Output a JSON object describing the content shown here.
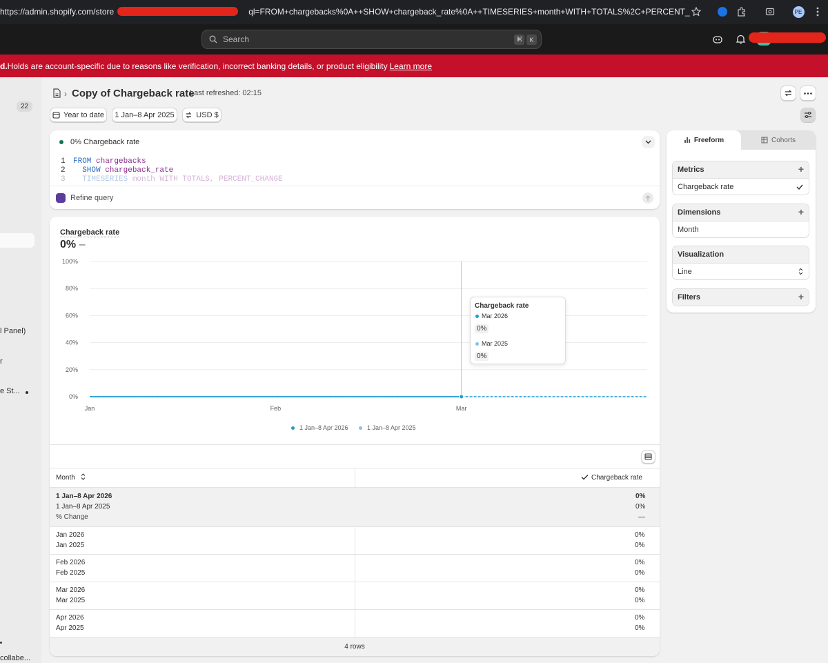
{
  "browser": {
    "url": "https://admin.shopify.com/store",
    "url_tail": "ql=FROM+chargebacks%0A++SHOW+chargeback_rate%0A++TIMESERIES+month+WITH+TOTALS%2C+PERCENT_CHANG...",
    "profile_initials": "PE"
  },
  "topbar": {
    "search_placeholder": "Search",
    "shortcut_key1": "⌘",
    "shortcut_key2": "K"
  },
  "banner": {
    "text_prefix": "d.",
    "text": " Holds are account-specific due to reasons like verification, incorrect banking details, or product eligibility",
    "link": "Learn more",
    "color": "#c4102a"
  },
  "sidebar": {
    "badge": "22",
    "items": [
      "l Panel)",
      "r",
      "e St...",
      "collabe..."
    ]
  },
  "header": {
    "title": "Copy of Chargeback rate",
    "refreshed": "Last refreshed: 02:15"
  },
  "filters": {
    "date_range": "Year to date",
    "compare": "1 Jan–8 Apr 2025",
    "currency": "USD $"
  },
  "query": {
    "status": "0% Chargeback rate",
    "lines": [
      {
        "num": "1",
        "kw": "FROM",
        "rest": " chargebacks"
      },
      {
        "num": "2",
        "kw": "SHOW",
        "rest": " chargeback_rate"
      },
      {
        "num": "3",
        "kw": "TIMESERIES",
        "rest": " month WITH TOTALS, PERCENT_CHANGE"
      }
    ],
    "refine": "Refine query"
  },
  "chart_data": {
    "type": "line",
    "title": "Chargeback rate",
    "headline": "0%",
    "headline_delta": "–",
    "xlabel": "",
    "ylabel": "",
    "categories": [
      "Jan",
      "Feb",
      "Mar",
      "Apr"
    ],
    "x_tick_labels": [
      "Jan",
      "Feb",
      "Mar"
    ],
    "y_tick_labels": [
      "100%",
      "80%",
      "60%",
      "40%",
      "20%",
      "0%"
    ],
    "ylim": [
      0,
      100
    ],
    "grid": true,
    "legend_position": "bottom",
    "series": [
      {
        "name": "1 Jan–8 Apr 2026",
        "values": [
          0,
          0,
          0,
          0
        ],
        "color": "#1f9bd1",
        "style": "solid"
      },
      {
        "name": "1 Jan–8 Apr 2025",
        "values": [
          0,
          0,
          0,
          0
        ],
        "color": "#7fc4e6",
        "style": "dashed"
      }
    ],
    "tooltip": {
      "title": "Chargeback rate",
      "rows": [
        {
          "label": "Mar 2026",
          "value": "0%"
        },
        {
          "label": "Mar 2025",
          "value": "0%"
        }
      ]
    }
  },
  "table": {
    "col_month": "Month",
    "col_metric": "Chargeback rate",
    "totals": {
      "row1_label": "1 Jan–8 Apr 2026",
      "row1_value": "0%",
      "row2_label": "1 Jan–8 Apr 2025",
      "row2_value": "0%",
      "row3_label": "% Change",
      "row3_value": "—"
    },
    "rows": [
      {
        "a": "Jan 2026",
        "b": "Jan 2025",
        "va": "0%",
        "vb": "0%"
      },
      {
        "a": "Feb 2026",
        "b": "Feb 2025",
        "va": "0%",
        "vb": "0%"
      },
      {
        "a": "Mar 2026",
        "b": "Mar 2025",
        "va": "0%",
        "vb": "0%"
      },
      {
        "a": "Apr 2026",
        "b": "Apr 2025",
        "va": "0%",
        "vb": "0%"
      }
    ],
    "footer": "4 rows"
  },
  "panel": {
    "tab_freeform": "Freeform",
    "tab_cohorts": "Cohorts",
    "metrics_title": "Metrics",
    "metrics_value": "Chargeback rate",
    "dimensions_title": "Dimensions",
    "dimensions_value": "Month",
    "visualization_title": "Visualization",
    "visualization_value": "Line",
    "filters_title": "Filters"
  }
}
